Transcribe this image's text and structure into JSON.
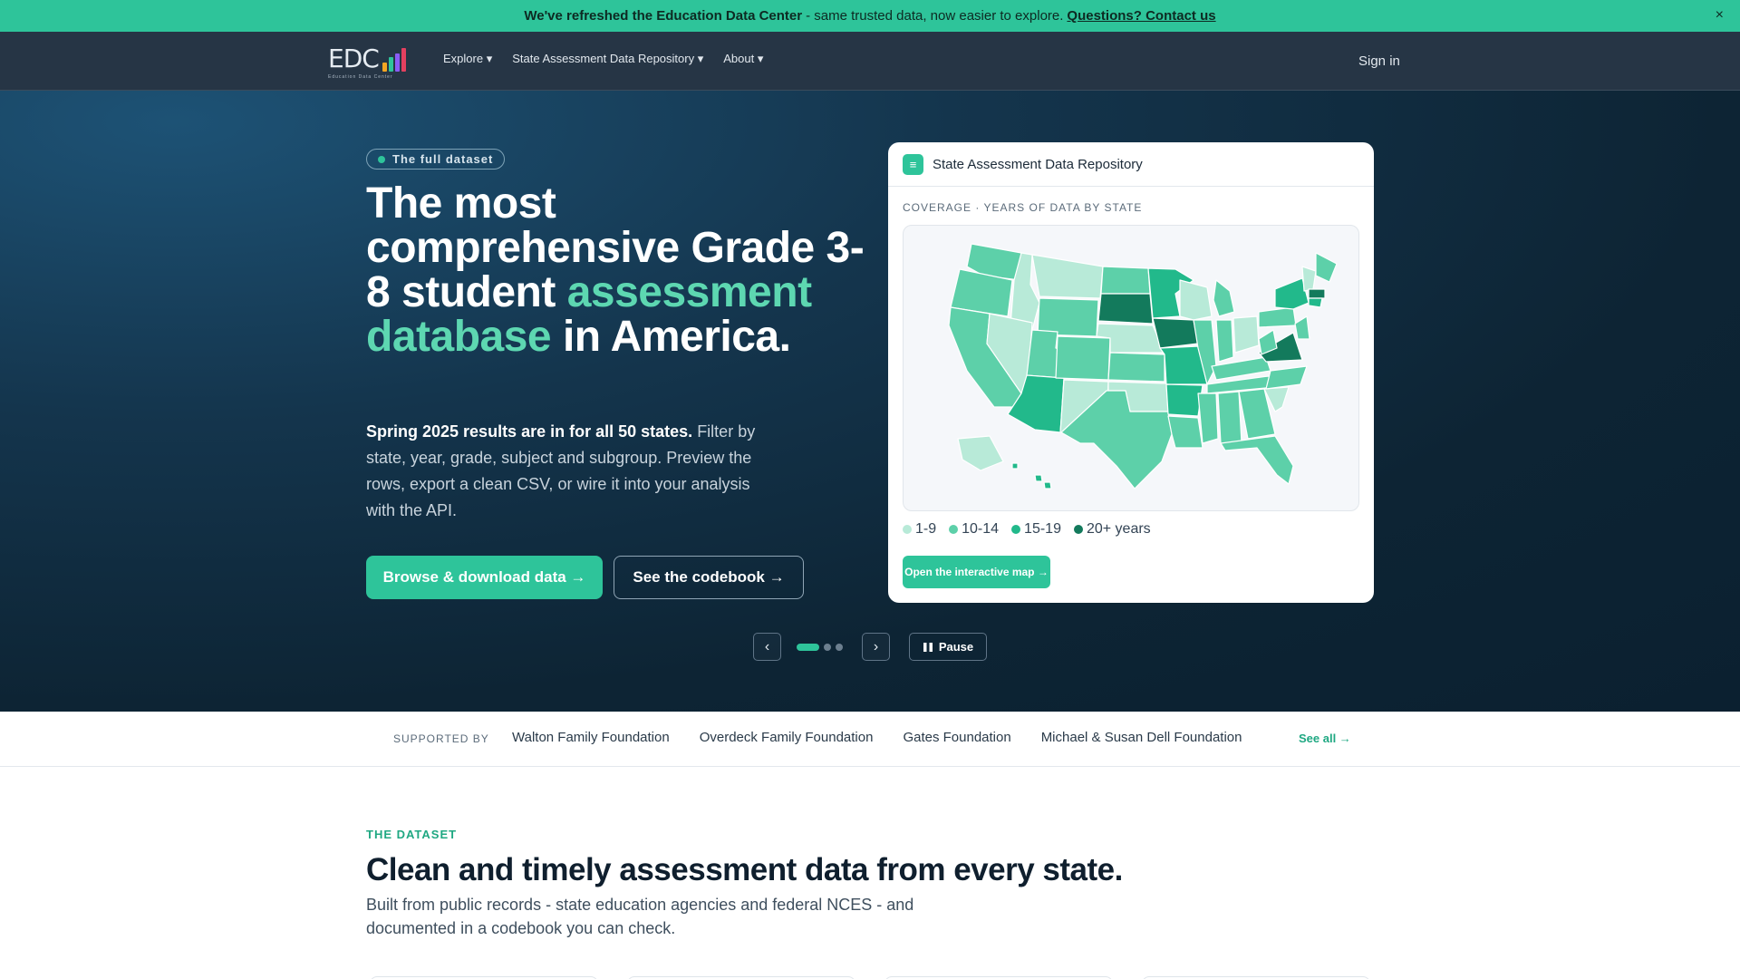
{
  "announcement": {
    "bold": "We've refreshed the Education Data Center",
    "text": "- same trusted data, now easier to explore.",
    "link": "Questions? Contact us",
    "close": "×"
  },
  "nav": {
    "logo": "EDC",
    "logo_sub": "Education Data Center",
    "items": [
      {
        "label": "Explore ▾"
      },
      {
        "label": "State Assessment Data Repository ▾"
      },
      {
        "label": "About ▾"
      }
    ],
    "sign_in": "Sign in"
  },
  "hero": {
    "badge": "The full dataset",
    "headline_1": "The most comprehensive Grade 3-8 student",
    "headline_accent": "assessment database",
    "headline_2": "in America.",
    "lede_bold": "Spring 2025 results are in for all 50 states.",
    "lede": "Filter by state, year, grade, subject and subgroup. Preview the rows, export a clean CSV, or wire it into your analysis with the API.",
    "primary_button": "Browse & download data →",
    "secondary_button": "See the codebook →",
    "prev": "‹",
    "next": "›",
    "pause": "Pause",
    "slides": 3,
    "active_slide": 1
  },
  "card": {
    "title": "State Assessment Data Repository",
    "icon": "list-icon",
    "coverage_label": "COVERAGE · YEARS OF DATA BY STATE",
    "legend": [
      {
        "label": "1-9",
        "color": "#b8ead8"
      },
      {
        "label": "10-14",
        "color": "#5dd0a9"
      },
      {
        "label": "15-19",
        "color": "#22b98b"
      },
      {
        "label": "20+ years",
        "color": "#137a5c"
      }
    ],
    "button": "Open the interactive map →"
  },
  "supporters": {
    "label": "SUPPORTED BY",
    "items": [
      "Walton Family Foundation",
      "Overdeck Family Foundation",
      "Gates Foundation",
      "Michael & Susan Dell Foundation"
    ],
    "see_all": "See all →"
  },
  "dataset": {
    "eyebrow": "THE DATASET",
    "title": "Clean and timely assessment data from every state.",
    "description": "Built from public records - state education agencies and federal NCES - and documented in a codebook you can check."
  },
  "colors": {
    "accent": "#2ec49a",
    "nav_bg": "#263545",
    "hero_bg": "#0d2434"
  }
}
